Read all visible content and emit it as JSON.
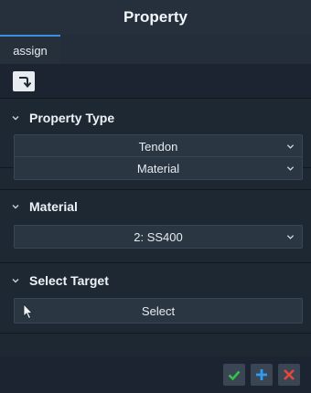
{
  "window": {
    "title": "Property"
  },
  "tabs": [
    {
      "label": "assign"
    }
  ],
  "toolbar": {
    "icon": "return-arrow-icon"
  },
  "sections": {
    "property_type": {
      "title": "Property Type",
      "dropdown1_value": "Tendon",
      "dropdown2_value": "Material"
    },
    "material": {
      "title": "Material",
      "dropdown_value": "2: SS400"
    },
    "select_target": {
      "title": "Select Target",
      "select_label": "Select"
    }
  },
  "footer": {
    "confirm_icon": "check-icon",
    "add_icon": "plus-icon",
    "close_icon": "close-icon"
  },
  "colors": {
    "accent_blue": "#3c8ee6",
    "check_green": "#35c24a",
    "plus_blue": "#2f9cf0",
    "close_red": "#e8463a"
  }
}
